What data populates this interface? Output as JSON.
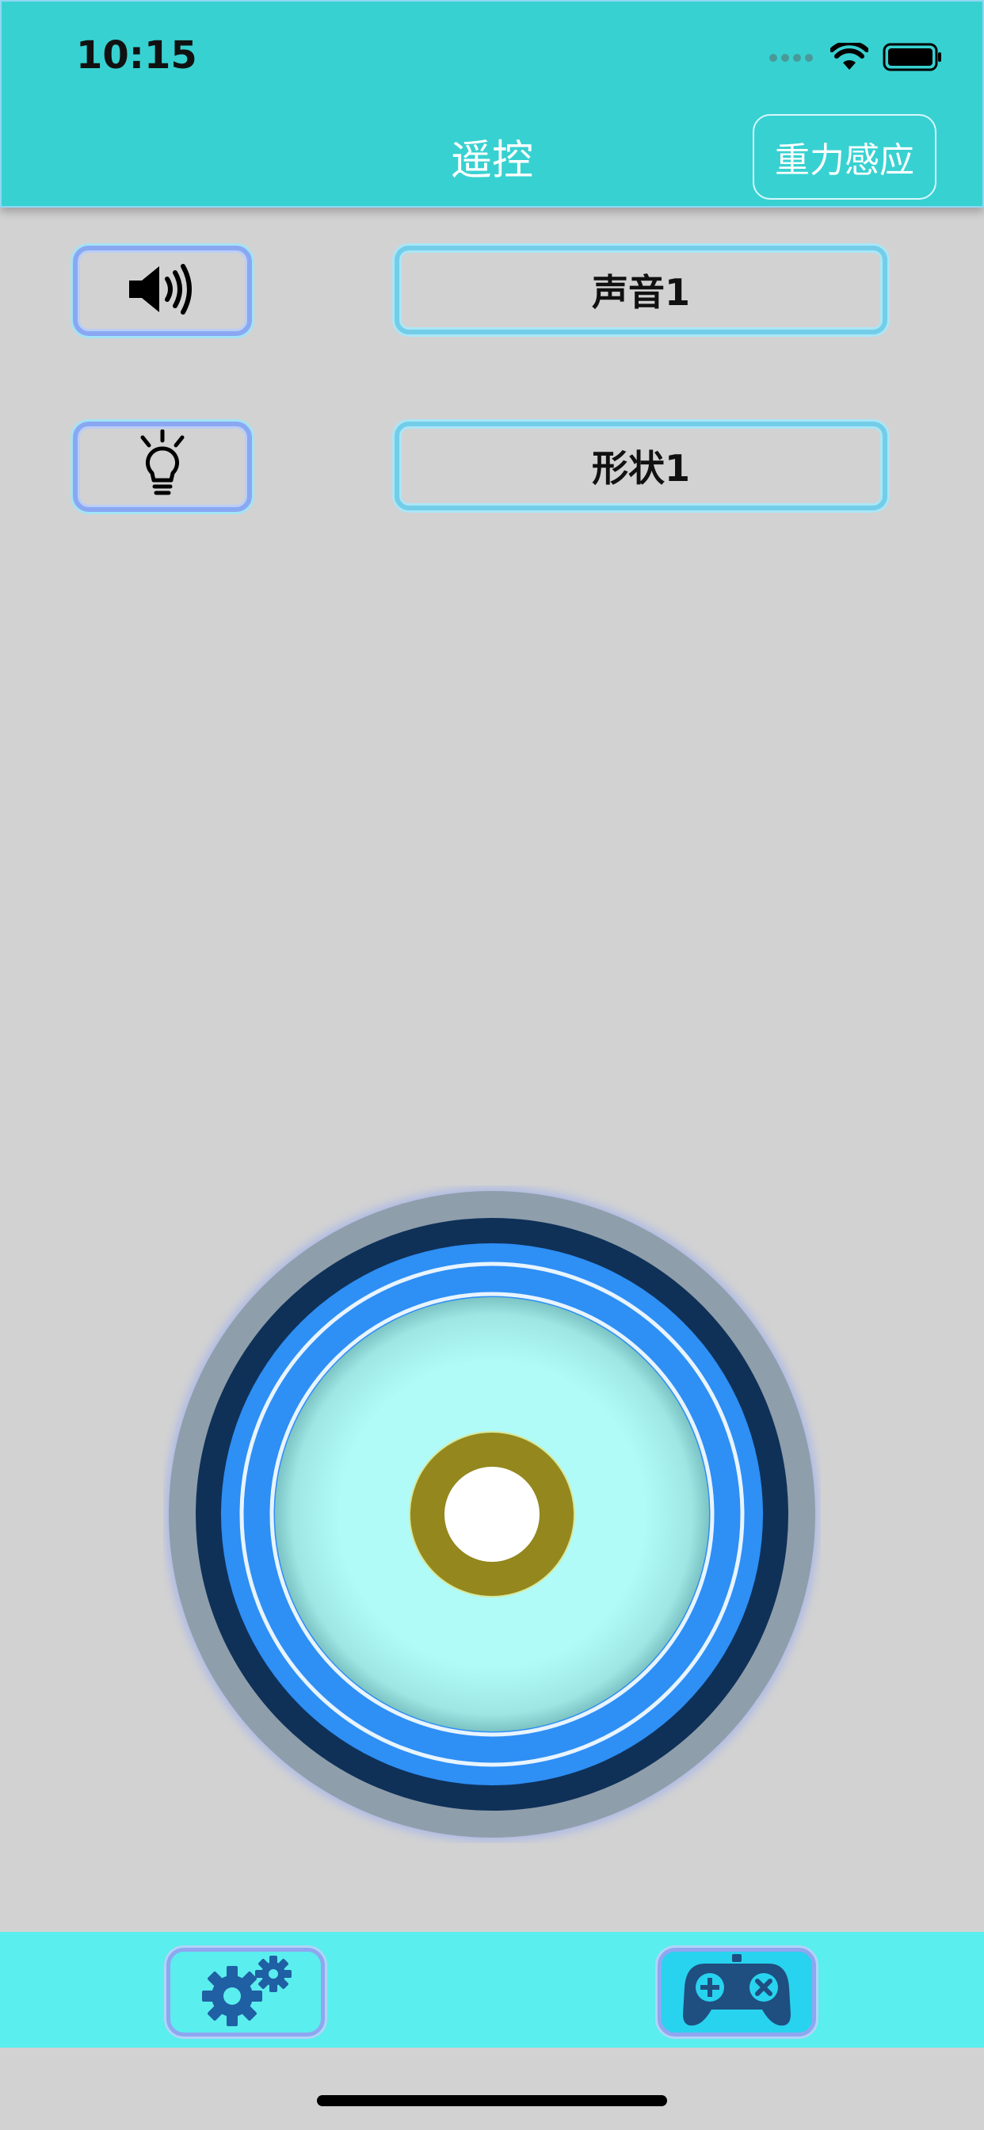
{
  "status_bar": {
    "time": "10:15",
    "icons": [
      "signal-dots-icon",
      "wifi-icon",
      "battery-icon"
    ]
  },
  "nav": {
    "title": "遥控",
    "gravity_button_label": "重力感应"
  },
  "controls": {
    "sound": {
      "icon": "speaker-icon",
      "value": "声音1"
    },
    "shape": {
      "icon": "lightbulb-icon",
      "value": "形状1"
    }
  },
  "joystick": {
    "icon": "joystick-knob"
  },
  "tab_bar": {
    "items": [
      {
        "icon": "gears-icon",
        "active": false
      },
      {
        "icon": "gamepad-icon",
        "active": true
      }
    ]
  },
  "colors": {
    "header_bg": "#38d1d1",
    "page_bg": "#d2d2d2",
    "bottom_bar_bg": "#5aeeee",
    "joystick_outer": "#8f9eab",
    "joystick_dark_ring": "#0f3158",
    "joystick_blue_ring": "#2e8ff5",
    "joystick_inner": "#b0fbf8",
    "knob": "#93871e",
    "icon_blue": "#1f5fa3"
  }
}
